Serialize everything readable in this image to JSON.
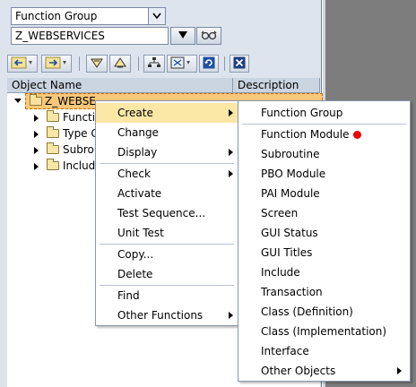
{
  "selector": {
    "combo_value": "Function Group",
    "object_value": "Z_WEBSERVICES"
  },
  "grid": {
    "col_object": "Object Name",
    "col_description": "Description"
  },
  "tree": {
    "root": "Z_WEBSE",
    "children": [
      "Functio",
      "Type G",
      "Subrou",
      "Include"
    ]
  },
  "context_menu": {
    "items": [
      "Create",
      "Change",
      "Display",
      "Check",
      "Activate",
      "Test Sequence...",
      "Unit Test",
      "Copy...",
      "Delete",
      "Find",
      "Other Functions"
    ]
  },
  "create_submenu": {
    "items": [
      "Function Group",
      "Function Module",
      "Subroutine",
      "PBO Module",
      "PAI Module",
      "Screen",
      "GUI Status",
      "GUI Titles",
      "Include",
      "Transaction",
      "Class (Definition)",
      "Class (Implementation)",
      "Interface",
      "Other Objects"
    ]
  },
  "colors": {
    "highlight": "#fbe7a6",
    "marker": "#e00000",
    "panel_bg": "#dde4ee"
  },
  "icons": [
    "dropdown-icon",
    "execute-icon",
    "glasses-icon",
    "back-icon",
    "forward-icon",
    "tree-up-icon",
    "tree-expand-icon",
    "hierarchy-icon",
    "display-icon",
    "refresh-icon",
    "close-icon"
  ]
}
